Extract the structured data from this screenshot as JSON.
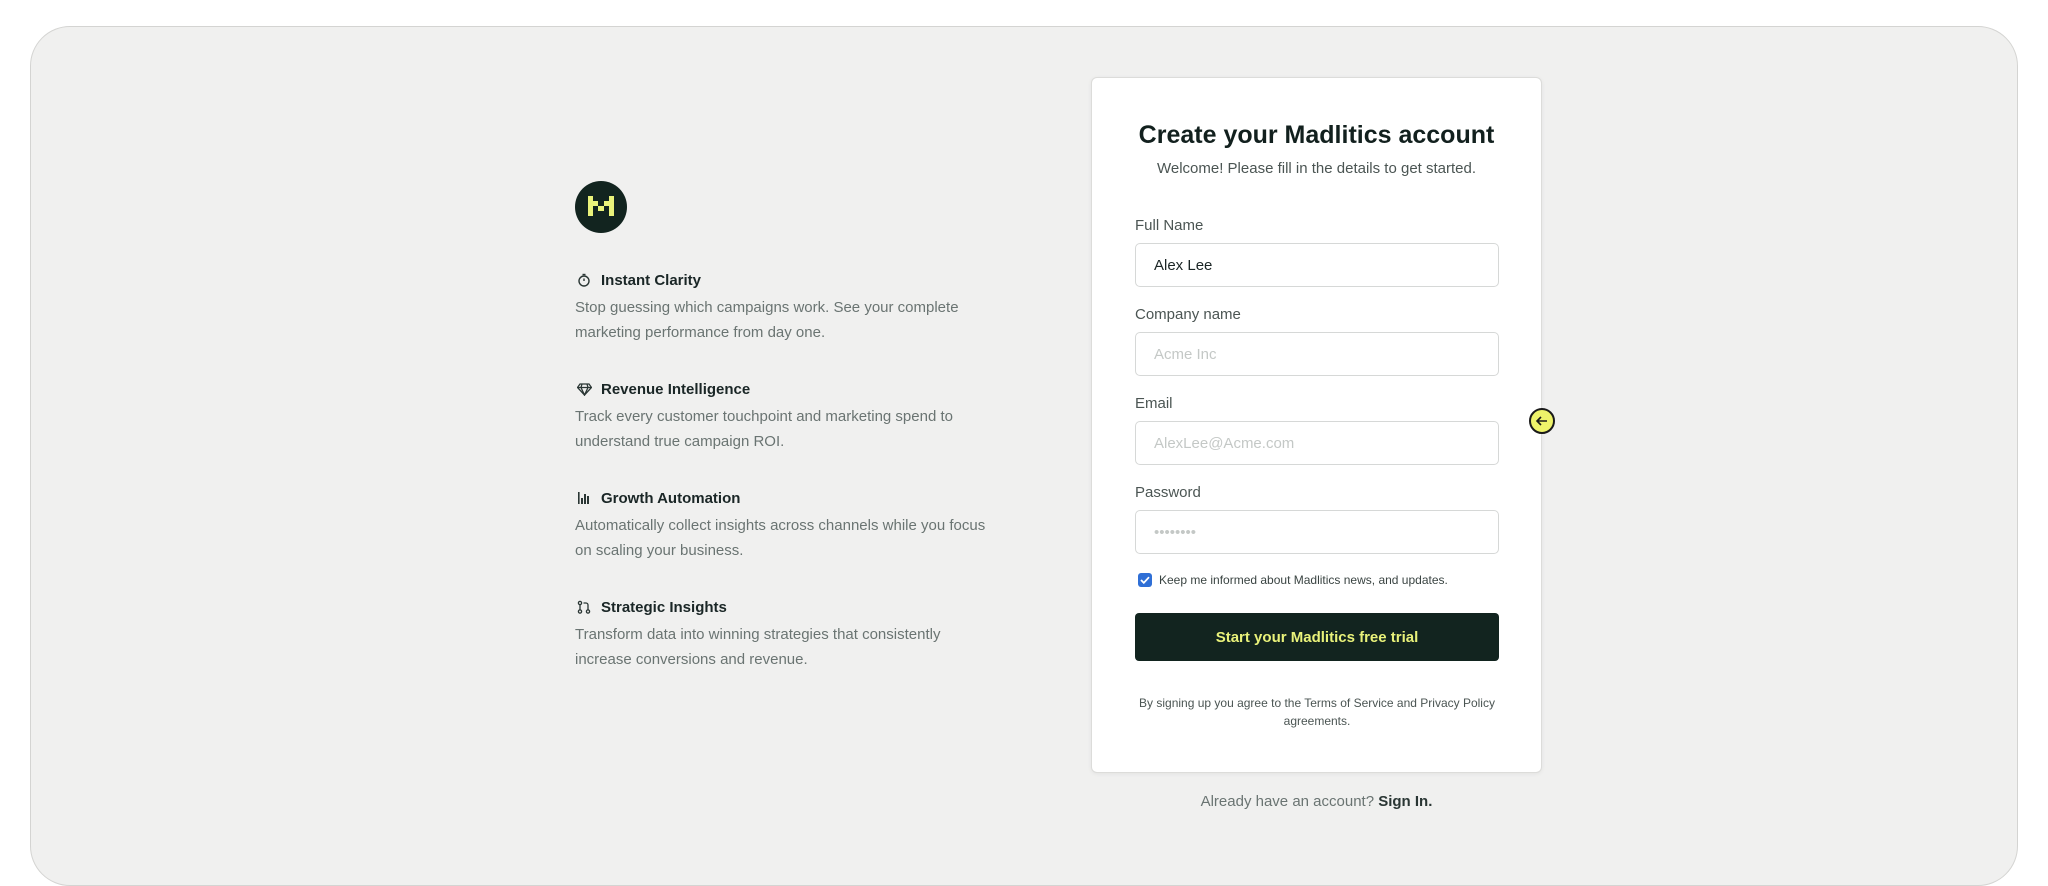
{
  "brand": {
    "logo_icon": "madlitics-m-logo",
    "accent": "#e9f27a",
    "dark": "#12241f"
  },
  "features": [
    {
      "icon": "timer-icon",
      "title": "Instant Clarity",
      "desc": "Stop guessing which campaigns work. See your complete marketing performance from day one."
    },
    {
      "icon": "diamond-icon",
      "title": "Revenue Intelligence",
      "desc": "Track every customer touchpoint and marketing spend to understand true campaign ROI."
    },
    {
      "icon": "bar-chart-icon",
      "title": "Growth Automation",
      "desc": "Automatically collect insights across channels while you focus on scaling your business."
    },
    {
      "icon": "git-pull-request-icon",
      "title": "Strategic Insights",
      "desc": "Transform data into winning strategies that consistently increase conversions and revenue."
    }
  ],
  "form": {
    "title": "Create your Madlitics account",
    "subtitle": "Welcome! Please fill in the details to get started.",
    "full_name": {
      "label": "Full Name",
      "value": "Alex Lee"
    },
    "company": {
      "label": "Company name",
      "placeholder": "Acme Inc"
    },
    "email": {
      "label": "Email",
      "placeholder": "AlexLee@Acme.com"
    },
    "password": {
      "label": "Password",
      "placeholder": "••••••••"
    },
    "newsletter": {
      "label": "Keep me informed about Madlitics news, and updates.",
      "checked": true
    },
    "submit_label": "Start your Madlitics free trial",
    "terms": "By signing up you agree to the Terms of Service and Privacy Policy agreements."
  },
  "signin": {
    "prompt": "Already have an account?",
    "link": "Sign In."
  }
}
